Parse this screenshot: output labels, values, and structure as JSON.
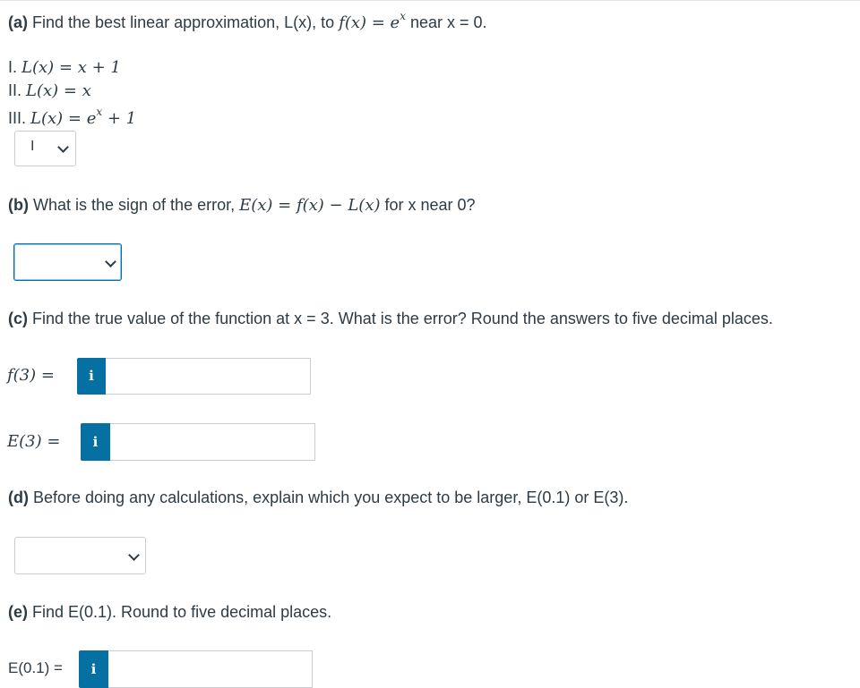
{
  "part_a": {
    "prefix": "(a)",
    "text_before": " Find the best linear approximation, L(x), to ",
    "math_fx": "f(x) = e",
    "math_sup": "x",
    "text_after": " near x = 0.",
    "options": [
      {
        "roman": "I.",
        "expr": "L(x) = x + 1",
        "sup": ""
      },
      {
        "roman": "II.",
        "expr": "L(x) = x",
        "sup": ""
      },
      {
        "roman": "III.",
        "expr": "L(x) = e",
        "sup": "x",
        "tail": " + 1"
      }
    ],
    "select_value": "I"
  },
  "part_b": {
    "prefix": "(b)",
    "text_before": " What is the sign of the error, ",
    "math": "E(x) = f(x) − L(x)",
    "text_after": " for x near 0?",
    "select_value": ""
  },
  "part_c": {
    "prefix": "(c)",
    "text": " Find the true value of the function at x = 3. What is the error? Round the answers to five decimal places.",
    "f3_label": "f(3) =",
    "e3_label": "E(3) =",
    "f3_value": "",
    "e3_value": "",
    "info_glyph": "i"
  },
  "part_d": {
    "prefix": "(d)",
    "text": " Before doing any calculations, explain which you expect to be larger, E(0.1) or E(3).",
    "select_value": ""
  },
  "part_e": {
    "prefix": "(e)",
    "text": " Find E(0.1). Round to five decimal places.",
    "e01_label": "E(0.1) =",
    "e01_value": "",
    "info_glyph": "i"
  },
  "colors": {
    "info_blue": "#0770a3",
    "text": "#2d3b45",
    "border": "#c7cdd1"
  },
  "icons": {
    "dropdown": "chevron-down-icon",
    "info": "info-icon"
  }
}
